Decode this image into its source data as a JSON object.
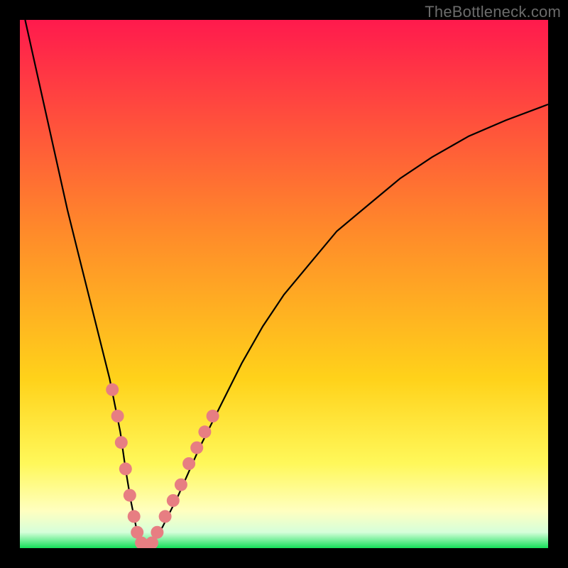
{
  "watermark": "TheBottleneck.com",
  "colors": {
    "frame": "#000000",
    "grad_top": "#ff1a4d",
    "grad_mid1": "#ff6a2a",
    "grad_mid2": "#ffd21a",
    "grad_low": "#fff85a",
    "grad_pale": "#ffffc0",
    "grad_green": "#15e05a",
    "curve": "#000000",
    "dots": "#e77e82"
  },
  "chart_data": {
    "type": "line",
    "title": "",
    "xlabel": "",
    "ylabel": "",
    "xlim": [
      0,
      100
    ],
    "ylim": [
      0,
      100
    ],
    "series": [
      {
        "name": "bottleneck-curve",
        "x": [
          1,
          3,
          5,
          7,
          9,
          11,
          13,
          15,
          17,
          19,
          20,
          21,
          22,
          23,
          24,
          25,
          27,
          30,
          34,
          38,
          42,
          46,
          50,
          55,
          60,
          66,
          72,
          78,
          85,
          92,
          100
        ],
        "y": [
          100,
          91,
          82,
          73,
          64,
          56,
          48,
          40,
          32,
          22,
          15,
          9,
          4,
          1,
          0,
          1,
          4,
          10,
          19,
          27,
          35,
          42,
          48,
          54,
          60,
          65,
          70,
          74,
          78,
          81,
          84
        ]
      }
    ],
    "scatter": {
      "name": "highlighted-points",
      "points": [
        {
          "x": 17.5,
          "y": 30
        },
        {
          "x": 18.5,
          "y": 25
        },
        {
          "x": 19.2,
          "y": 20
        },
        {
          "x": 20.0,
          "y": 15
        },
        {
          "x": 20.8,
          "y": 10
        },
        {
          "x": 21.6,
          "y": 6
        },
        {
          "x": 22.2,
          "y": 3
        },
        {
          "x": 23.0,
          "y": 1
        },
        {
          "x": 24.0,
          "y": 0
        },
        {
          "x": 25.0,
          "y": 1
        },
        {
          "x": 26.0,
          "y": 3
        },
        {
          "x": 27.5,
          "y": 6
        },
        {
          "x": 29.0,
          "y": 9
        },
        {
          "x": 30.5,
          "y": 12
        },
        {
          "x": 32.0,
          "y": 16
        },
        {
          "x": 33.5,
          "y": 19
        },
        {
          "x": 35.0,
          "y": 22
        },
        {
          "x": 36.5,
          "y": 25
        }
      ]
    },
    "gradient_bands": [
      {
        "from": 100,
        "to": 30,
        "colors": [
          "#ff1a4d",
          "#ff802a",
          "#ffd21a"
        ]
      },
      {
        "from": 30,
        "to": 10,
        "colors": [
          "#ffe84a",
          "#fff85a"
        ]
      },
      {
        "from": 10,
        "to": 3,
        "colors": [
          "#ffffc0",
          "#f6ffd0"
        ]
      },
      {
        "from": 3,
        "to": 0,
        "colors": [
          "#15e05a",
          "#0fcf50"
        ]
      }
    ]
  }
}
